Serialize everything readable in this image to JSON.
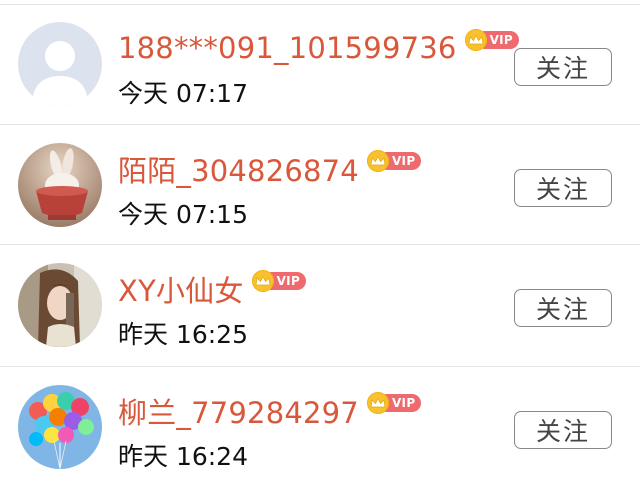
{
  "follow_list": {
    "items": [
      {
        "username": "188***091_101599736",
        "vip_label": "VIP",
        "time": "今天 07:17",
        "follow_label": "关注",
        "avatar": "default-user-silhouette"
      },
      {
        "username": "陌陌_304826874",
        "vip_label": "VIP",
        "time": "今天 07:15",
        "follow_label": "关注",
        "avatar": "rabbit-in-cup-photo"
      },
      {
        "username": "XY小仙女",
        "vip_label": "VIP",
        "time": "昨天 16:25",
        "follow_label": "关注",
        "avatar": "girl-portrait-photo"
      },
      {
        "username": "柳兰_779284297",
        "vip_label": "VIP",
        "time": "昨天 16:24",
        "follow_label": "关注",
        "avatar": "colorful-balloons-photo"
      }
    ]
  },
  "colors": {
    "username": "#d9583b",
    "vip_pill": "#ee6a6e",
    "vip_crown": "#f7c22e",
    "divider": "#e3e3e3",
    "button_border": "#888888"
  }
}
